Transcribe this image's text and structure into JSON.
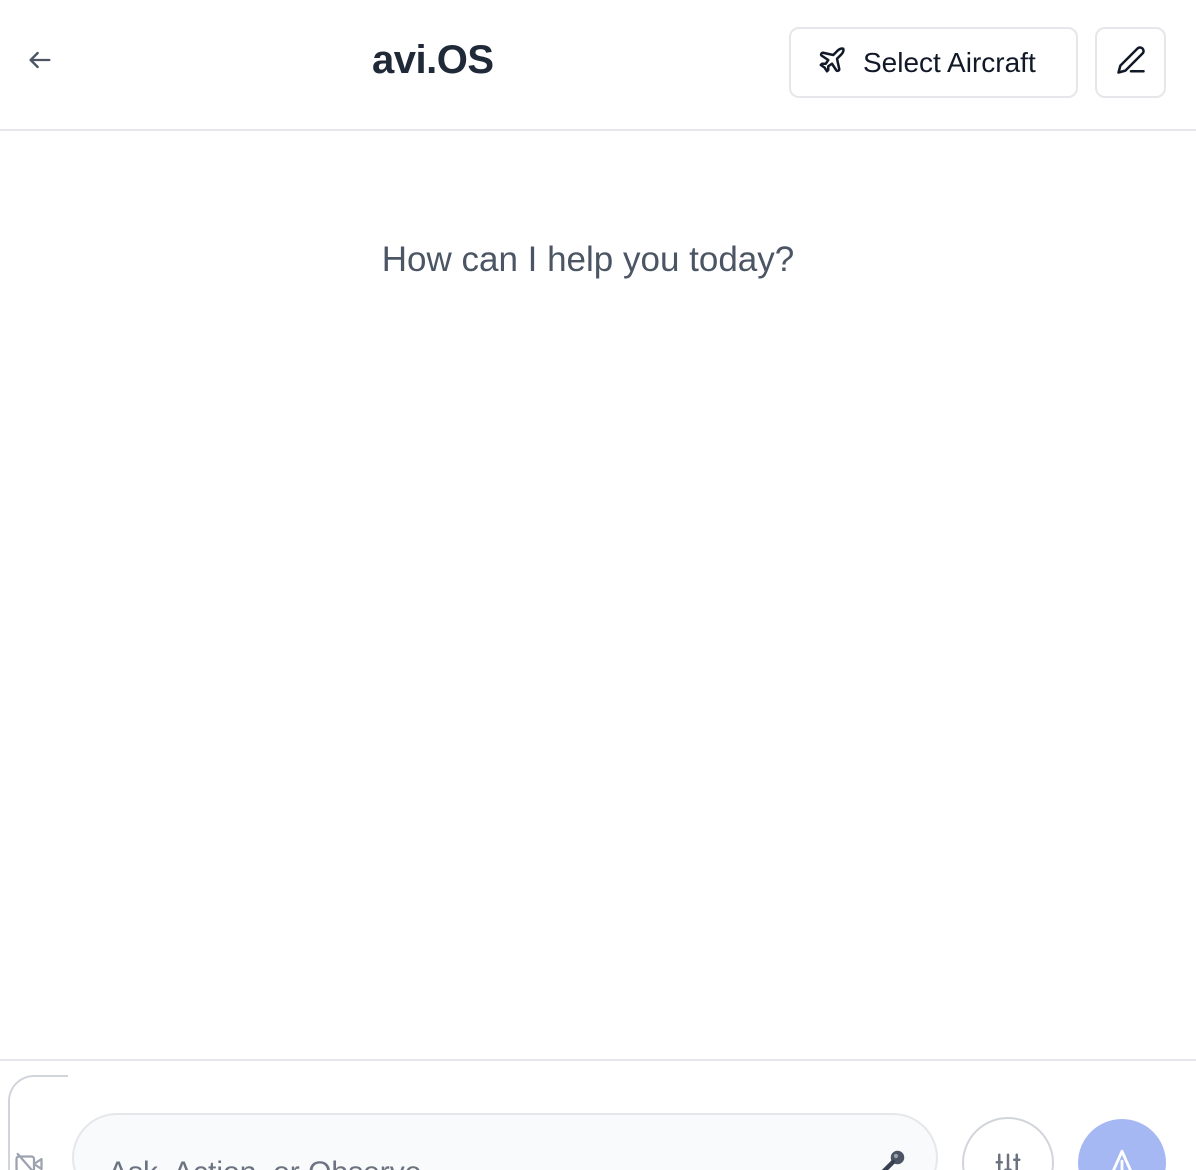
{
  "header": {
    "back_icon": "arrow-left-icon",
    "title": "avi.OS",
    "select_aircraft_label": "Select Aircraft",
    "aircraft_icon": "plane-icon",
    "edit_icon": "pencil-icon"
  },
  "main": {
    "greeting": "How can I help you today?"
  },
  "composer": {
    "placeholder": "Ask, Action, or Observe",
    "video_icon": "video-icon",
    "mic_icon": "microphone-icon",
    "settings_icon": "sliders-icon",
    "send_icon": "send-icon"
  },
  "colors": {
    "border": "#e5e7eb",
    "send_button": "#a5b8f3",
    "title": "#1f2937",
    "muted_text": "#4b5563"
  }
}
